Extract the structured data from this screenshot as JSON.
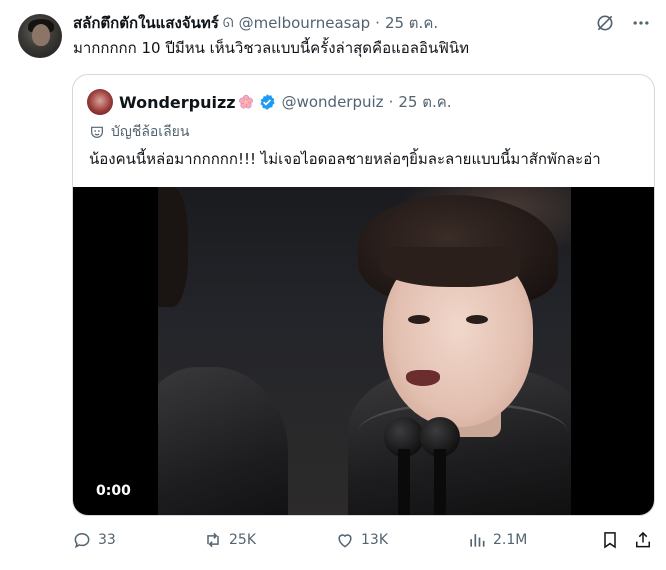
{
  "tweet": {
    "display_name": "สลักตึกตักในแสงจันทร์",
    "mute_mark": "ᘏ",
    "handle": "@melbourneasap",
    "dot": "·",
    "time": "25 ต.ค.",
    "text": "มากกกกก 10 ปีมีหน เห็นวิชวลแบบนี้ครั้งล่าสุดคือแอลอินฟินิท",
    "top_icons": [
      "grok-circle-slash-icon",
      "more-dots-icon"
    ]
  },
  "quote": {
    "display_name": "Wonderpuizz",
    "emoji": "cherry-blossom-icon",
    "verified": "verified-badge-icon",
    "handle": "@wonderpuiz",
    "dot": "·",
    "time": "25 ต.ค.",
    "parody_label": "บัญชีล้อเลียน",
    "text": "น้องคนนี้หล่อมากกกกก!!! ไม่เจอไอดอลชายหล่อๆยิ้มละลายแบบนี้มาสักพักละอ่า",
    "video": {
      "duration": "0:00"
    }
  },
  "actions": {
    "replies": "33",
    "reposts": "25K",
    "likes": "13K",
    "views": "2.1M"
  },
  "colors": {
    "muted_text": "#536471",
    "primary_text": "#0f1419",
    "border": "#cfd9de",
    "verified_blue": "#1d9bf0"
  }
}
